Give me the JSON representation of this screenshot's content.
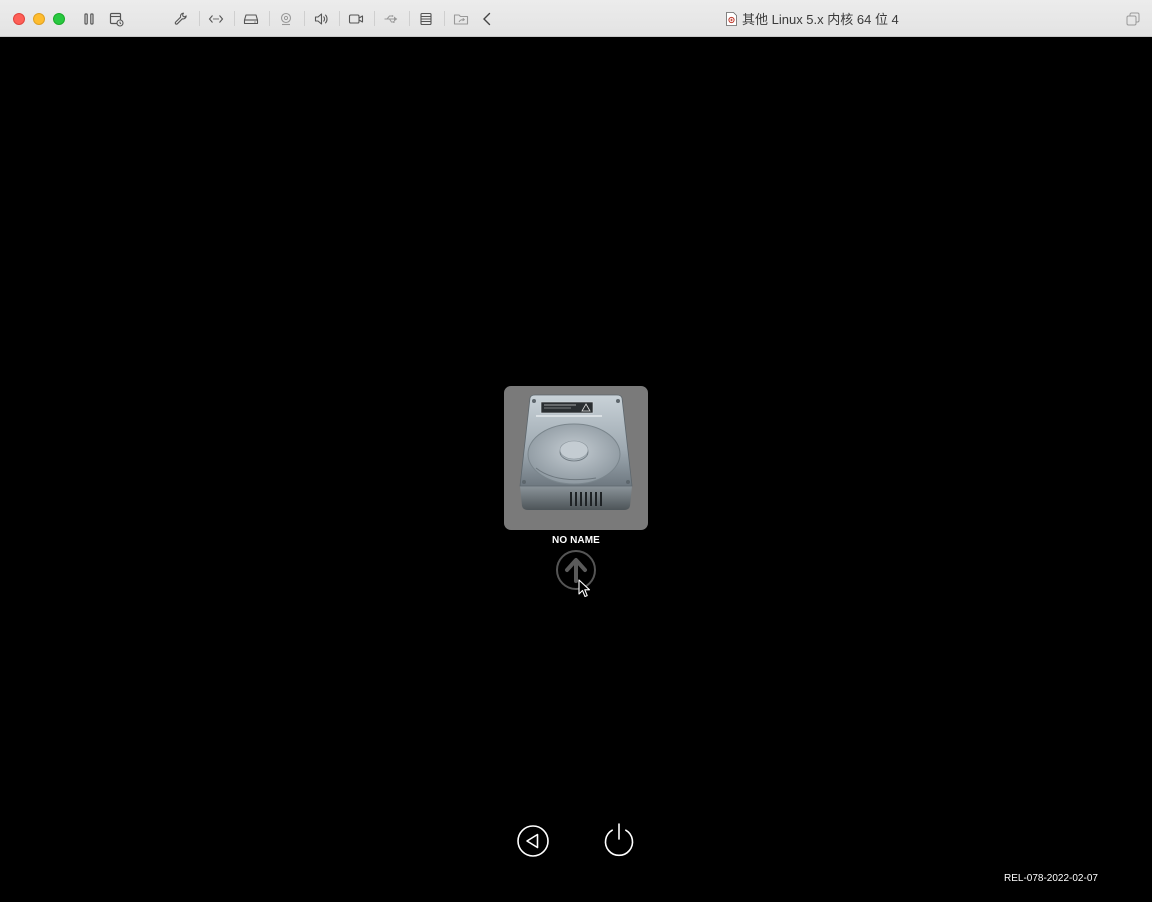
{
  "window": {
    "title": "其他 Linux 5.x 内核 64 位 4",
    "controls": [
      "close",
      "minimize",
      "zoom"
    ]
  },
  "toolbar": {
    "icons": [
      "pause-icon",
      "snapshot-icon",
      "settings-wrench-icon",
      "network-icon",
      "hard-disk-icon",
      "camera-icon",
      "sound-icon",
      "video-icon",
      "usb-icon",
      "printer-icon",
      "shared-folder-icon",
      "collapse-chevron-icon"
    ]
  },
  "boot_picker": {
    "disk_label": "NO NAME",
    "disk_icon": "hard-disk-icon",
    "boot_button_icon": "up-arrow-icon",
    "back_button_icon": "back-triangle-icon",
    "power_button_icon": "power-icon"
  },
  "footer": {
    "version": "REL-078-2022-02-07"
  },
  "colors": {
    "background": "#000000",
    "tile": "#7a7a7a",
    "close": "#fe5f57",
    "minimize": "#febc2e",
    "zoom": "#28c840"
  }
}
